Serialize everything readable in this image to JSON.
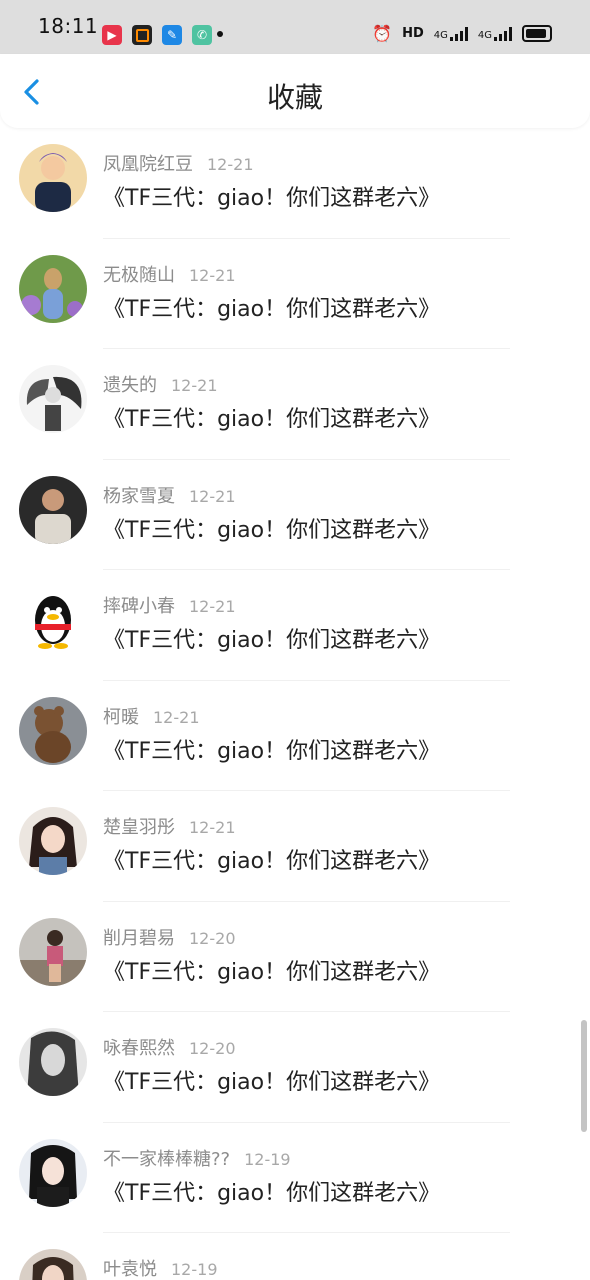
{
  "status_bar": {
    "time": "18:11",
    "hd": "HD",
    "net1": "4G",
    "net2": "4G"
  },
  "header": {
    "title": "收藏"
  },
  "items": [
    {
      "name": "凤凰院红豆",
      "date": "12-21",
      "text": "《TF三代：giao！你们这群老六》"
    },
    {
      "name": "无极随山",
      "date": "12-21",
      "text": "《TF三代：giao！你们这群老六》"
    },
    {
      "name": "遗失的",
      "date": "12-21",
      "text": "《TF三代：giao！你们这群老六》"
    },
    {
      "name": "杨家雪夏",
      "date": "12-21",
      "text": "《TF三代：giao！你们这群老六》"
    },
    {
      "name": "摔碑小春",
      "date": "12-21",
      "text": "《TF三代：giao！你们这群老六》"
    },
    {
      "name": "柯暖",
      "date": "12-21",
      "text": "《TF三代：giao！你们这群老六》"
    },
    {
      "name": "楚皇羽彤",
      "date": "12-21",
      "text": "《TF三代：giao！你们这群老六》"
    },
    {
      "name": "削月碧易",
      "date": "12-20",
      "text": "《TF三代：giao！你们这群老六》"
    },
    {
      "name": "咏春熙然",
      "date": "12-20",
      "text": "《TF三代：giao！你们这群老六》"
    },
    {
      "name": "不一家棒棒糖??",
      "date": "12-19",
      "text": "《TF三代：giao！你们这群老六》"
    },
    {
      "name": "叶袁悦",
      "date": "12-19",
      "text": ""
    }
  ]
}
